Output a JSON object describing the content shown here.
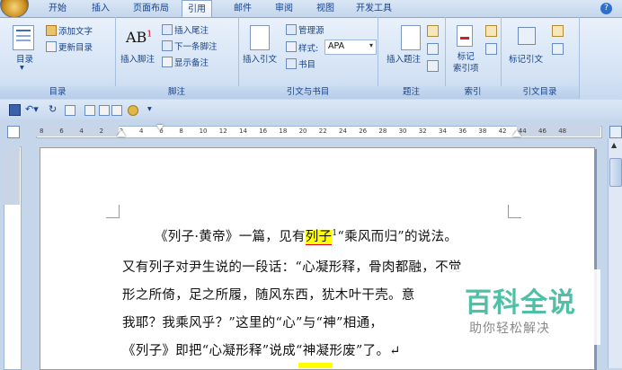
{
  "tabs": [
    "开始",
    "插入",
    "页面布局",
    "引用",
    "邮件",
    "审阅",
    "视图",
    "开发工具"
  ],
  "active_tab": "引用",
  "help_label": "?",
  "ribbon": {
    "toc": {
      "button": "目录",
      "add_text": "添加文字",
      "update": "更新目录",
      "group": "目录"
    },
    "footnote": {
      "insert_footnote": "插入脚注",
      "insert_endnote": "插入尾注",
      "next_footnote": "下一条脚注",
      "show_notes": "显示备注",
      "group": "脚注"
    },
    "citation": {
      "insert_citation": "插入引文",
      "manage_sources": "管理源",
      "style_label": "样式:",
      "style_value": "APA",
      "bibliography": "书目",
      "group": "引文与书目"
    },
    "caption": {
      "insert_caption": "插入题注",
      "group": "题注"
    },
    "index": {
      "mark_entry": "标记\n索引项",
      "group": "索引"
    },
    "toa": {
      "mark_citation": "标记引文",
      "group": "引文目录"
    }
  },
  "ruler_numbers": [
    "8",
    "6",
    "4",
    "2",
    "2",
    "4",
    "6",
    "8",
    "10",
    "12",
    "14",
    "16",
    "18",
    "20",
    "22",
    "24",
    "26",
    "28",
    "30",
    "32",
    "34",
    "36",
    "38",
    "42",
    "44",
    "46",
    "48"
  ],
  "document": {
    "line1": {
      "a": "《列子·黄帝》一篇，见有",
      "b": "列子",
      "c": "“乘风而归”的说法。"
    },
    "line2": "又有列子对尹生说的一段话：“心凝形释，骨肉都融，不觉",
    "line3": "形之所倚，足之所履，随风东西，犹木叶干壳。意",
    "line4": "我耶？我乘风乎？”这里的“心”与“神”相通，",
    "line5": "《列子》即把“心凝形释”说成“神凝形废”了。↵"
  },
  "watermark": {
    "title": "百科全说",
    "subtitle": "助你轻松解决"
  }
}
